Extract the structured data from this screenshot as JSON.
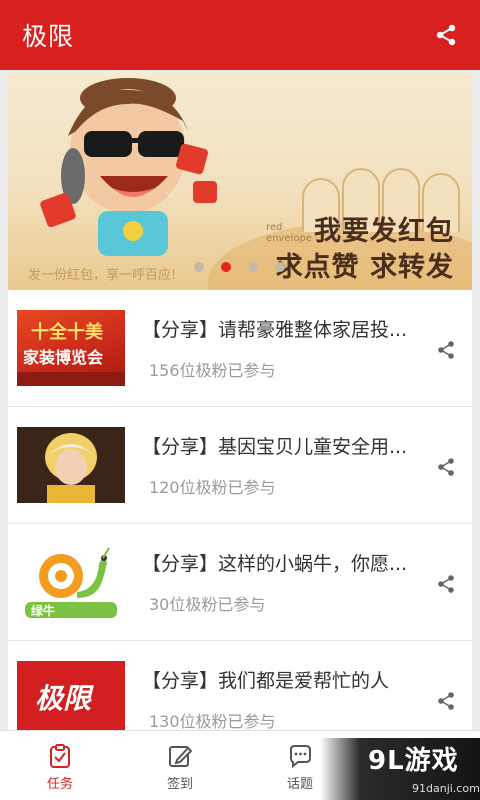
{
  "app": {
    "title": "极限"
  },
  "banner": {
    "tagline": "发一份红包，享一呼百应!",
    "headline_line1": "我要发红包",
    "headline_line2": "求点赞 求转发",
    "red_envelope_text_1": "red",
    "red_envelope_text_2": "envelope",
    "active_slide": 2,
    "slide_count": 4
  },
  "items": [
    {
      "title": "【分享】请帮豪雅整体家居投...",
      "count": "156位极粉已参与",
      "thumb_text_1": "十全十美",
      "thumb_text_2": "家装博览会"
    },
    {
      "title": "【分享】基因宝贝儿童安全用...",
      "count": "120位极粉已参与"
    },
    {
      "title": "【分享】这样的小蜗牛，你愿...",
      "count": "30位极粉已参与",
      "thumb_text": "绿牛"
    },
    {
      "title": "【分享】我们都是爱帮忙的人",
      "count": "130位极粉已参与",
      "thumb_text": "极限"
    }
  ],
  "tabs": [
    {
      "label": "任务",
      "icon": "task-icon",
      "active": true
    },
    {
      "label": "签到",
      "icon": "edit-icon",
      "active": false
    },
    {
      "label": "话题",
      "icon": "chat-icon",
      "active": false
    }
  ],
  "watermark": {
    "logo": "9L游戏",
    "url": "91danji.com"
  },
  "colors": {
    "brand": "#d8201f",
    "active_dot": "#e2261f"
  }
}
